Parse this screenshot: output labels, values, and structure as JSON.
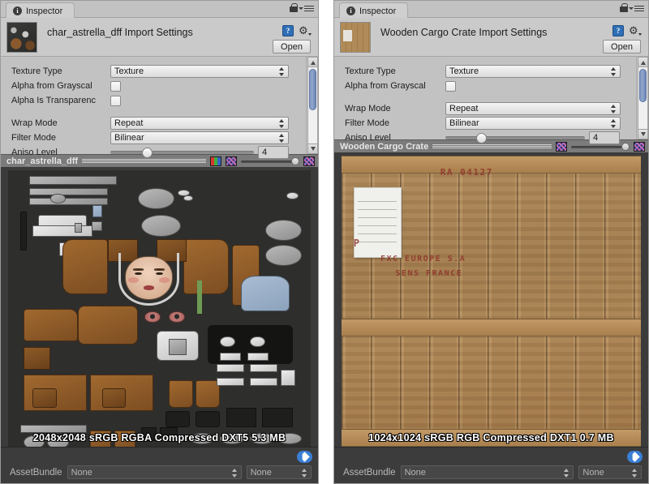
{
  "panels": [
    {
      "id": "left",
      "tab": {
        "label": "Inspector",
        "icon": "info-icon"
      },
      "tab_tools": {
        "lock": "lock-icon",
        "menu": "hamburger-menu-icon"
      },
      "header": {
        "title": "char_astrella_dff Import Settings",
        "thumbnail": "character-atlas-thumbnail",
        "help_icon": "?",
        "help_icon_name": "help-book-icon",
        "gear_icon_name": "gear-icon",
        "open_label": "Open"
      },
      "properties": [
        {
          "type": "popup",
          "label": "Texture Type",
          "value": "Texture",
          "name": "texture-type"
        },
        {
          "type": "checkbox",
          "label": "Alpha from Grayscal",
          "checked": false,
          "name": "alpha-from-grayscale"
        },
        {
          "type": "checkbox",
          "label": "Alpha Is Transparenc",
          "checked": false,
          "name": "alpha-is-transparency"
        },
        {
          "type": "popup",
          "label": "Wrap Mode",
          "value": "Repeat",
          "name": "wrap-mode"
        },
        {
          "type": "popup",
          "label": "Filter Mode",
          "value": "Bilinear",
          "name": "filter-mode"
        },
        {
          "type": "slider",
          "label": "Aniso Level",
          "value": "4",
          "percent": 25,
          "name": "aniso-level"
        }
      ],
      "scrollbar": {
        "thumb_top_pct": 2,
        "thumb_height_pct": 54
      },
      "preview": {
        "name": "char_astrella_dff",
        "show_rgb_icon": true,
        "rgb_icon": "rgb-channels-icon",
        "mip_icon": "mipmap-checker-icon",
        "mip_icon_right": "mipmap-checker-icon",
        "mip_slider_percent": 100,
        "info": "2048x2048 sRGB  RGBA Compressed DXT5   5.3 MB"
      },
      "footer": {
        "assetbundle_label": "AssetBundle",
        "bundle_value": "None",
        "variant_value": "None",
        "tag_icon": "asset-label-tag-icon"
      }
    },
    {
      "id": "right",
      "tab": {
        "label": "Inspector",
        "icon": "info-icon"
      },
      "tab_tools": {
        "lock": "lock-icon",
        "menu": "hamburger-menu-icon"
      },
      "header": {
        "title": "Wooden Cargo Crate Import Settings",
        "thumbnail": "wooden-crate-thumbnail",
        "help_icon": "?",
        "help_icon_name": "help-book-icon",
        "gear_icon_name": "gear-icon",
        "open_label": "Open"
      },
      "properties": [
        {
          "type": "popup",
          "label": "Texture Type",
          "value": "Texture",
          "name": "texture-type"
        },
        {
          "type": "checkbox",
          "label": "Alpha from Grayscal",
          "checked": false,
          "name": "alpha-from-grayscale"
        },
        {
          "type": "popup",
          "label": "Wrap Mode",
          "value": "Repeat",
          "name": "wrap-mode"
        },
        {
          "type": "popup",
          "label": "Filter Mode",
          "value": "Bilinear",
          "name": "filter-mode"
        },
        {
          "type": "slider",
          "label": "Aniso Level",
          "value": "4",
          "percent": 25,
          "name": "aniso-level"
        }
      ],
      "scrollbar": {
        "thumb_top_pct": 2,
        "thumb_height_pct": 54
      },
      "preview": {
        "name": "Wooden Cargo Crate",
        "show_rgb_icon": false,
        "mip_icon": "mipmap-checker-icon",
        "mip_icon_right": "mipmap-checker-icon",
        "mip_slider_percent": 100,
        "info": "1024x1024 sRGB  RGB Compressed DXT1   0.7 MB"
      },
      "footer": {
        "assetbundle_label": "AssetBundle",
        "bundle_value": "None",
        "variant_value": "None",
        "tag_icon": "asset-label-tag-icon"
      }
    }
  ],
  "crate_art": {
    "stencils": [
      {
        "text": "RA 04127",
        "x_pct": 33,
        "y_pct": 4,
        "size": 11
      },
      {
        "text": "P",
        "x_pct": 4,
        "y_pct": 28,
        "size": 12
      },
      {
        "text": "FXC EUROPE    S.A",
        "x_pct": 13,
        "y_pct": 34,
        "size": 10
      },
      {
        "text": "SENS FRANCE",
        "x_pct": 18,
        "y_pct": 39,
        "size": 10
      }
    ]
  },
  "colors": {
    "panel_bg": "#c2c2c2",
    "preview_bg": "#3b3b3b",
    "footer_bg": "#3c3c3c",
    "accent_blue": "#3a7fd5",
    "scroll_thumb": "#7d94c0",
    "stencil_red": "#8e3128"
  }
}
